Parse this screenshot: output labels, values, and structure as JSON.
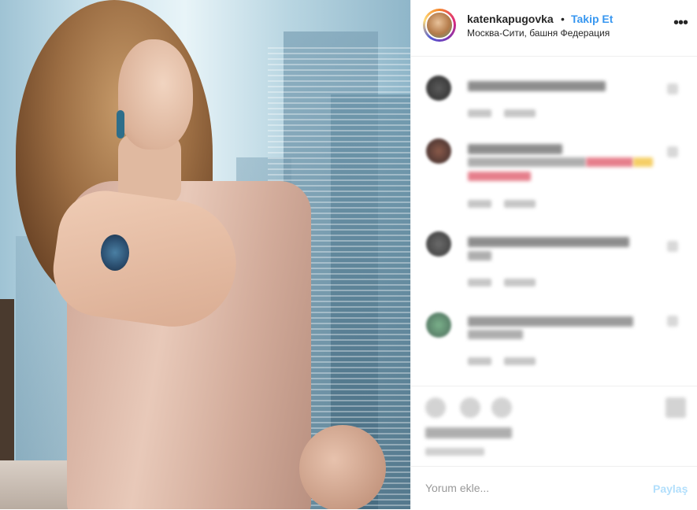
{
  "post": {
    "username": "katenkapugovka",
    "separator": "•",
    "follow_label": "Takip Et",
    "location": "Москва-Сити, башня Федерация",
    "more_icon": "ellipsis-icon"
  },
  "comments": [
    {
      "redacted": true
    },
    {
      "redacted": true
    },
    {
      "redacted": true
    },
    {
      "redacted": true
    }
  ],
  "comment_box": {
    "placeholder": "Yorum ekle...",
    "share_label": "Paylaş"
  },
  "colors": {
    "accent": "#3897f0",
    "share_disabled": "#b2dffc",
    "border": "#efefef"
  }
}
